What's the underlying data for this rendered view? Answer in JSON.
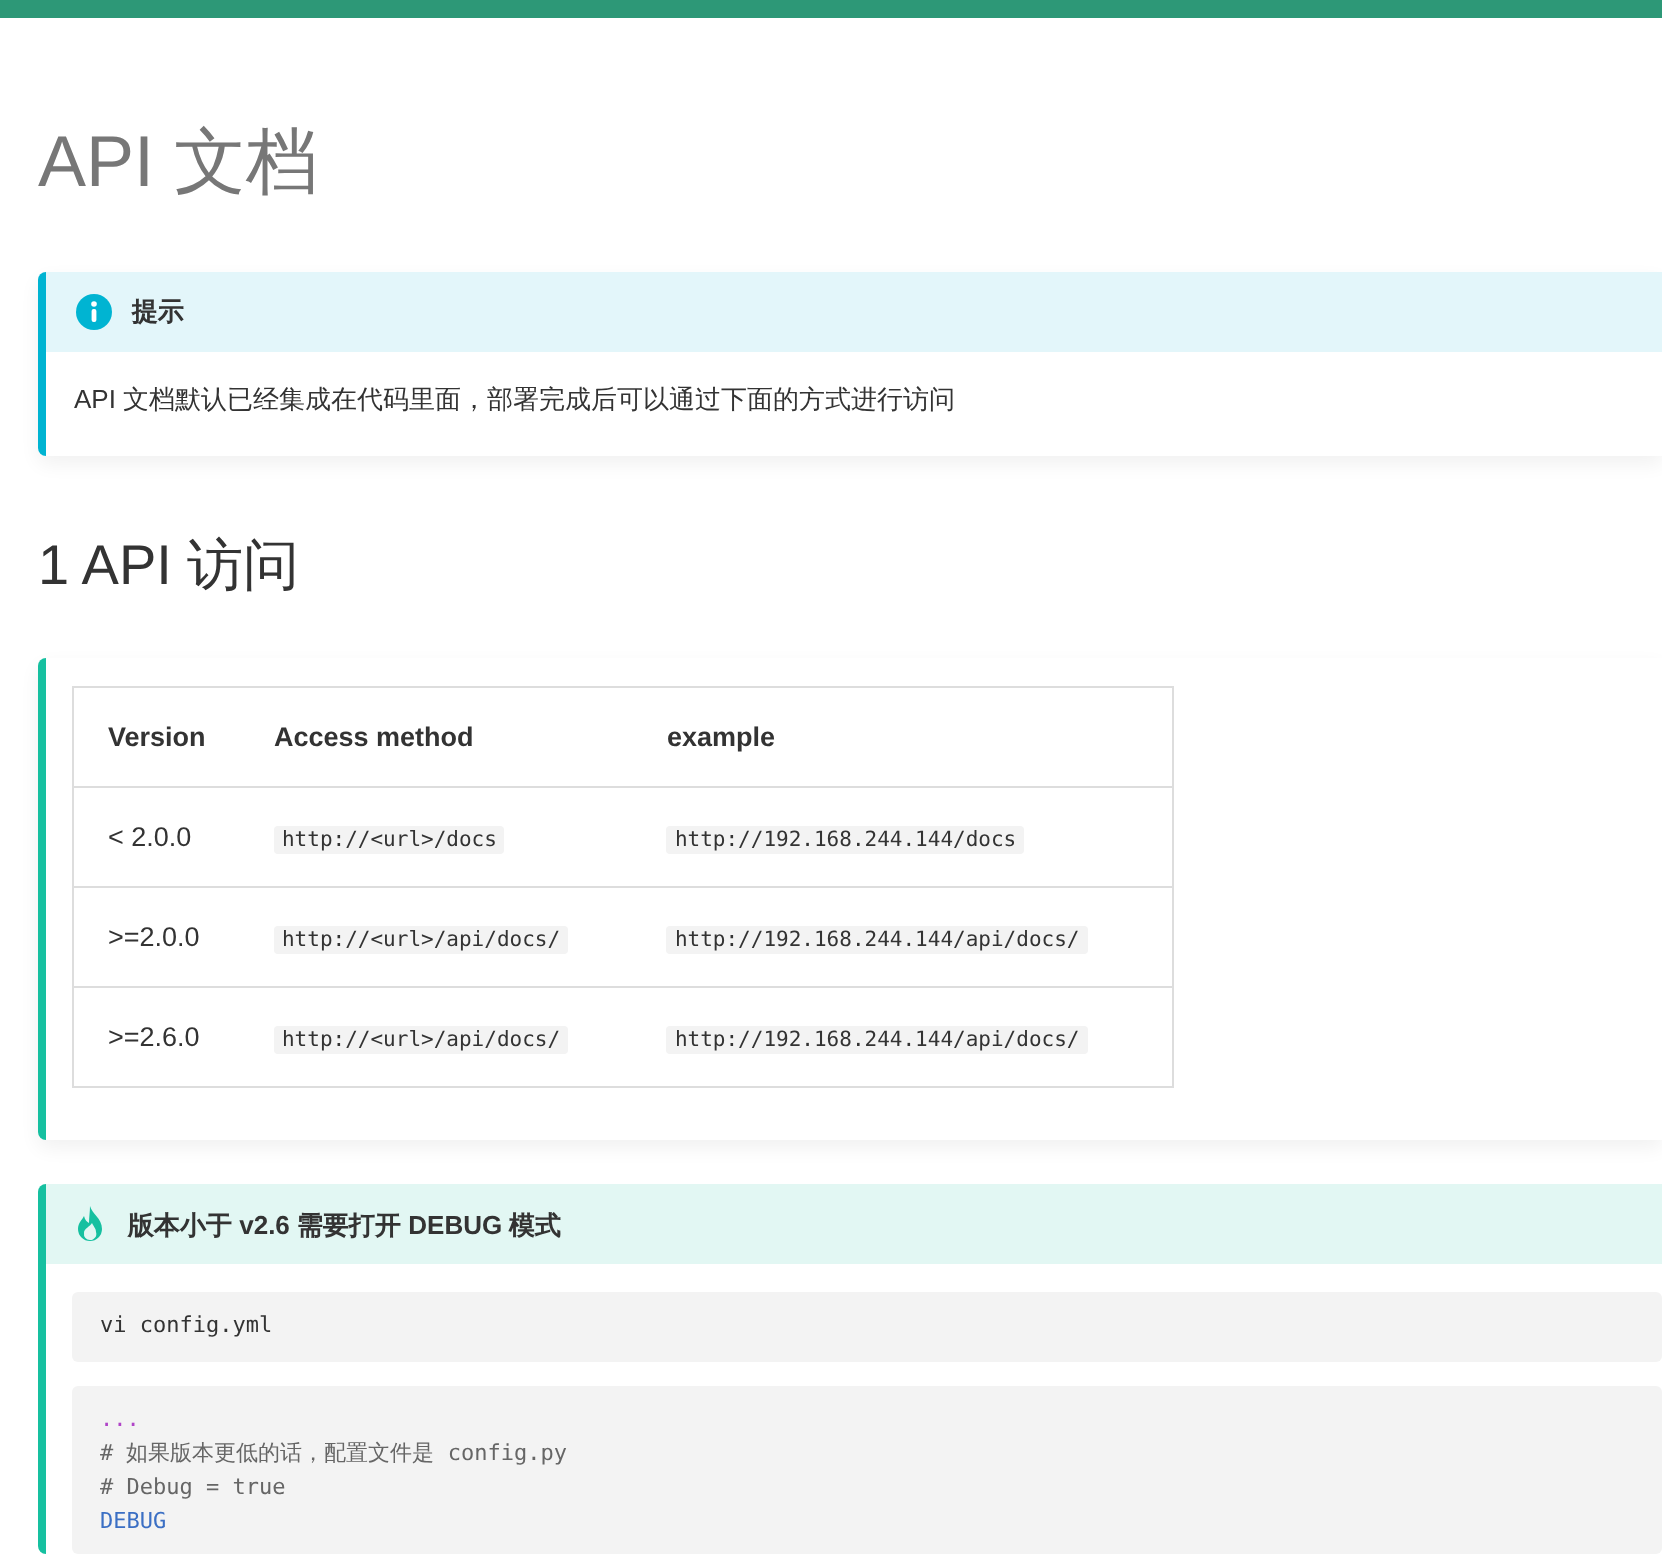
{
  "title": "API 文档",
  "tip": {
    "heading": "提示",
    "body": "API 文档默认已经集成在代码里面，部署完成后可以通过下面的方式进行访问"
  },
  "section_heading": "1 API 访问",
  "table": {
    "columns": [
      "Version",
      "Access method",
      "example"
    ],
    "rows": [
      [
        "< 2.0.0",
        "http://<url>/docs",
        "http://192.168.244.144/docs"
      ],
      [
        ">=2.0.0",
        "http://<url>/api/docs/",
        "http://192.168.244.144/api/docs/"
      ],
      [
        ">=2.6.0",
        "http://<url>/api/docs/",
        "http://192.168.244.144/api/docs/"
      ]
    ]
  },
  "debug_note": {
    "heading": "版本小于 v2.6 需要打开 DEBUG 模式",
    "command": "vi config.yml",
    "code_lines": [
      {
        "kind": "ellipsis",
        "text": "..."
      },
      {
        "kind": "comment",
        "text": "# 如果版本更低的话，配置文件是 config.py"
      },
      {
        "kind": "comment",
        "text": "# Debug = true"
      },
      {
        "kind": "code",
        "text": "DEBUG"
      }
    ]
  }
}
